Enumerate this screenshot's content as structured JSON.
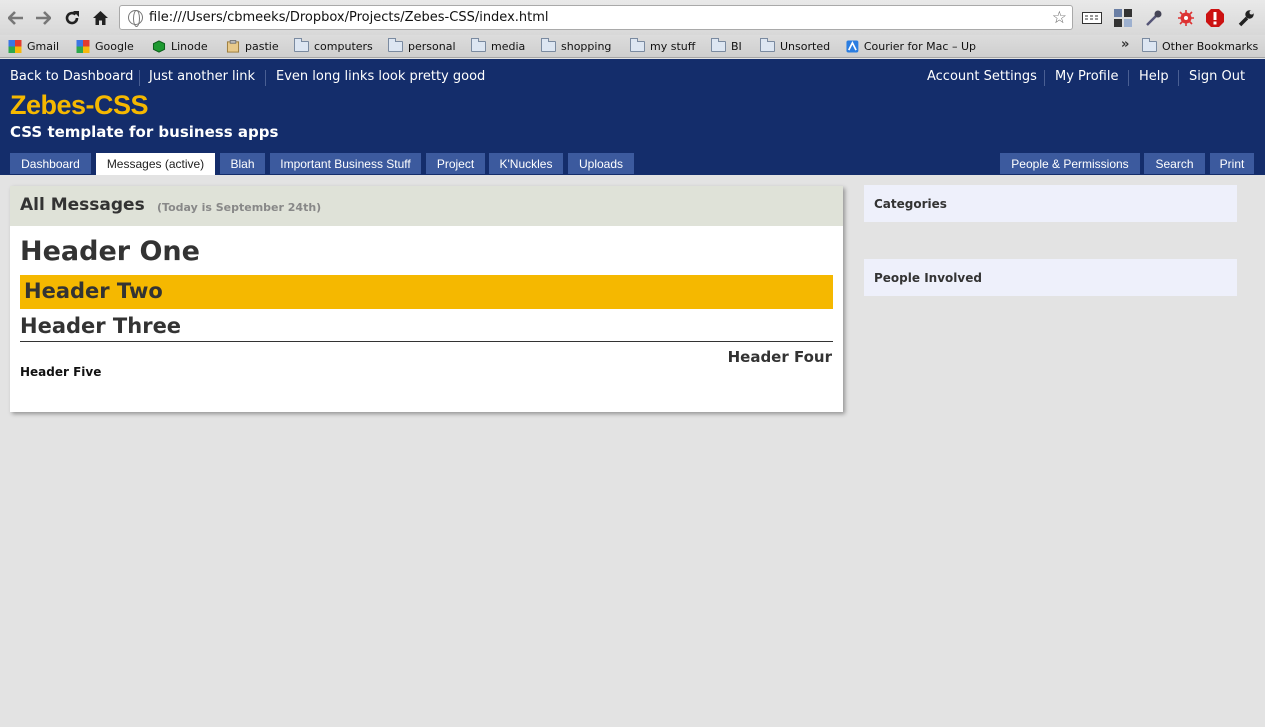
{
  "browser": {
    "url": "file:///Users/cbmeeks/Dropbox/Projects/Zebes-CSS/index.html",
    "icons": [
      "back-icon",
      "forward-icon",
      "reload-icon",
      "home-icon",
      "globe-icon",
      "star-icon"
    ],
    "bookmarks": [
      {
        "label": "Gmail",
        "icon": "google-icon"
      },
      {
        "label": "Google",
        "icon": "google-icon"
      },
      {
        "label": "Linode",
        "icon": "linode-icon"
      },
      {
        "label": "pastie",
        "icon": "clipboard-icon"
      },
      {
        "label": "computers",
        "icon": "folder-icon"
      },
      {
        "label": "personal",
        "icon": "folder-icon"
      },
      {
        "label": "media",
        "icon": "folder-icon"
      },
      {
        "label": "shopping",
        "icon": "folder-icon"
      },
      {
        "label": "my stuff",
        "icon": "folder-icon"
      },
      {
        "label": "BI",
        "icon": "folder-icon"
      },
      {
        "label": "Unsorted",
        "icon": "folder-icon"
      },
      {
        "label": "Courier for Mac – Up",
        "icon": "courier-icon"
      }
    ],
    "more_label": "»",
    "other_bookmarks": "Other Bookmarks"
  },
  "header": {
    "left_links": [
      "Back to Dashboard",
      "Just another link",
      "Even long links look pretty good"
    ],
    "right_links": [
      "Account Settings",
      "My Profile",
      "Help",
      "Sign Out"
    ],
    "title": "Zebes-CSS",
    "subtitle": "CSS template for business apps",
    "tabs_left": [
      "Dashboard",
      "Messages (active)",
      "Blah",
      "Important Business Stuff",
      "Project",
      "K'Nuckles",
      "Uploads"
    ],
    "tabs_right": [
      "People & Permissions",
      "Search",
      "Print"
    ],
    "active_tab": "Messages (active)"
  },
  "main": {
    "title": "All Messages",
    "date_note": "(Today is September 24th)",
    "header_one": "Header One",
    "header_two": "Header Two",
    "header_three": "Header Three",
    "header_four": "Header Four",
    "header_five": "Header Five"
  },
  "sidebar": {
    "boxes": [
      "Categories",
      "People Involved"
    ]
  },
  "colors": {
    "header_bg": "#142d6b",
    "brand_yellow": "#f5b800",
    "tab_bg": "#3c5a9e",
    "panel_head_bg": "#dfe2d8",
    "side_box_bg": "#eef0fb"
  }
}
